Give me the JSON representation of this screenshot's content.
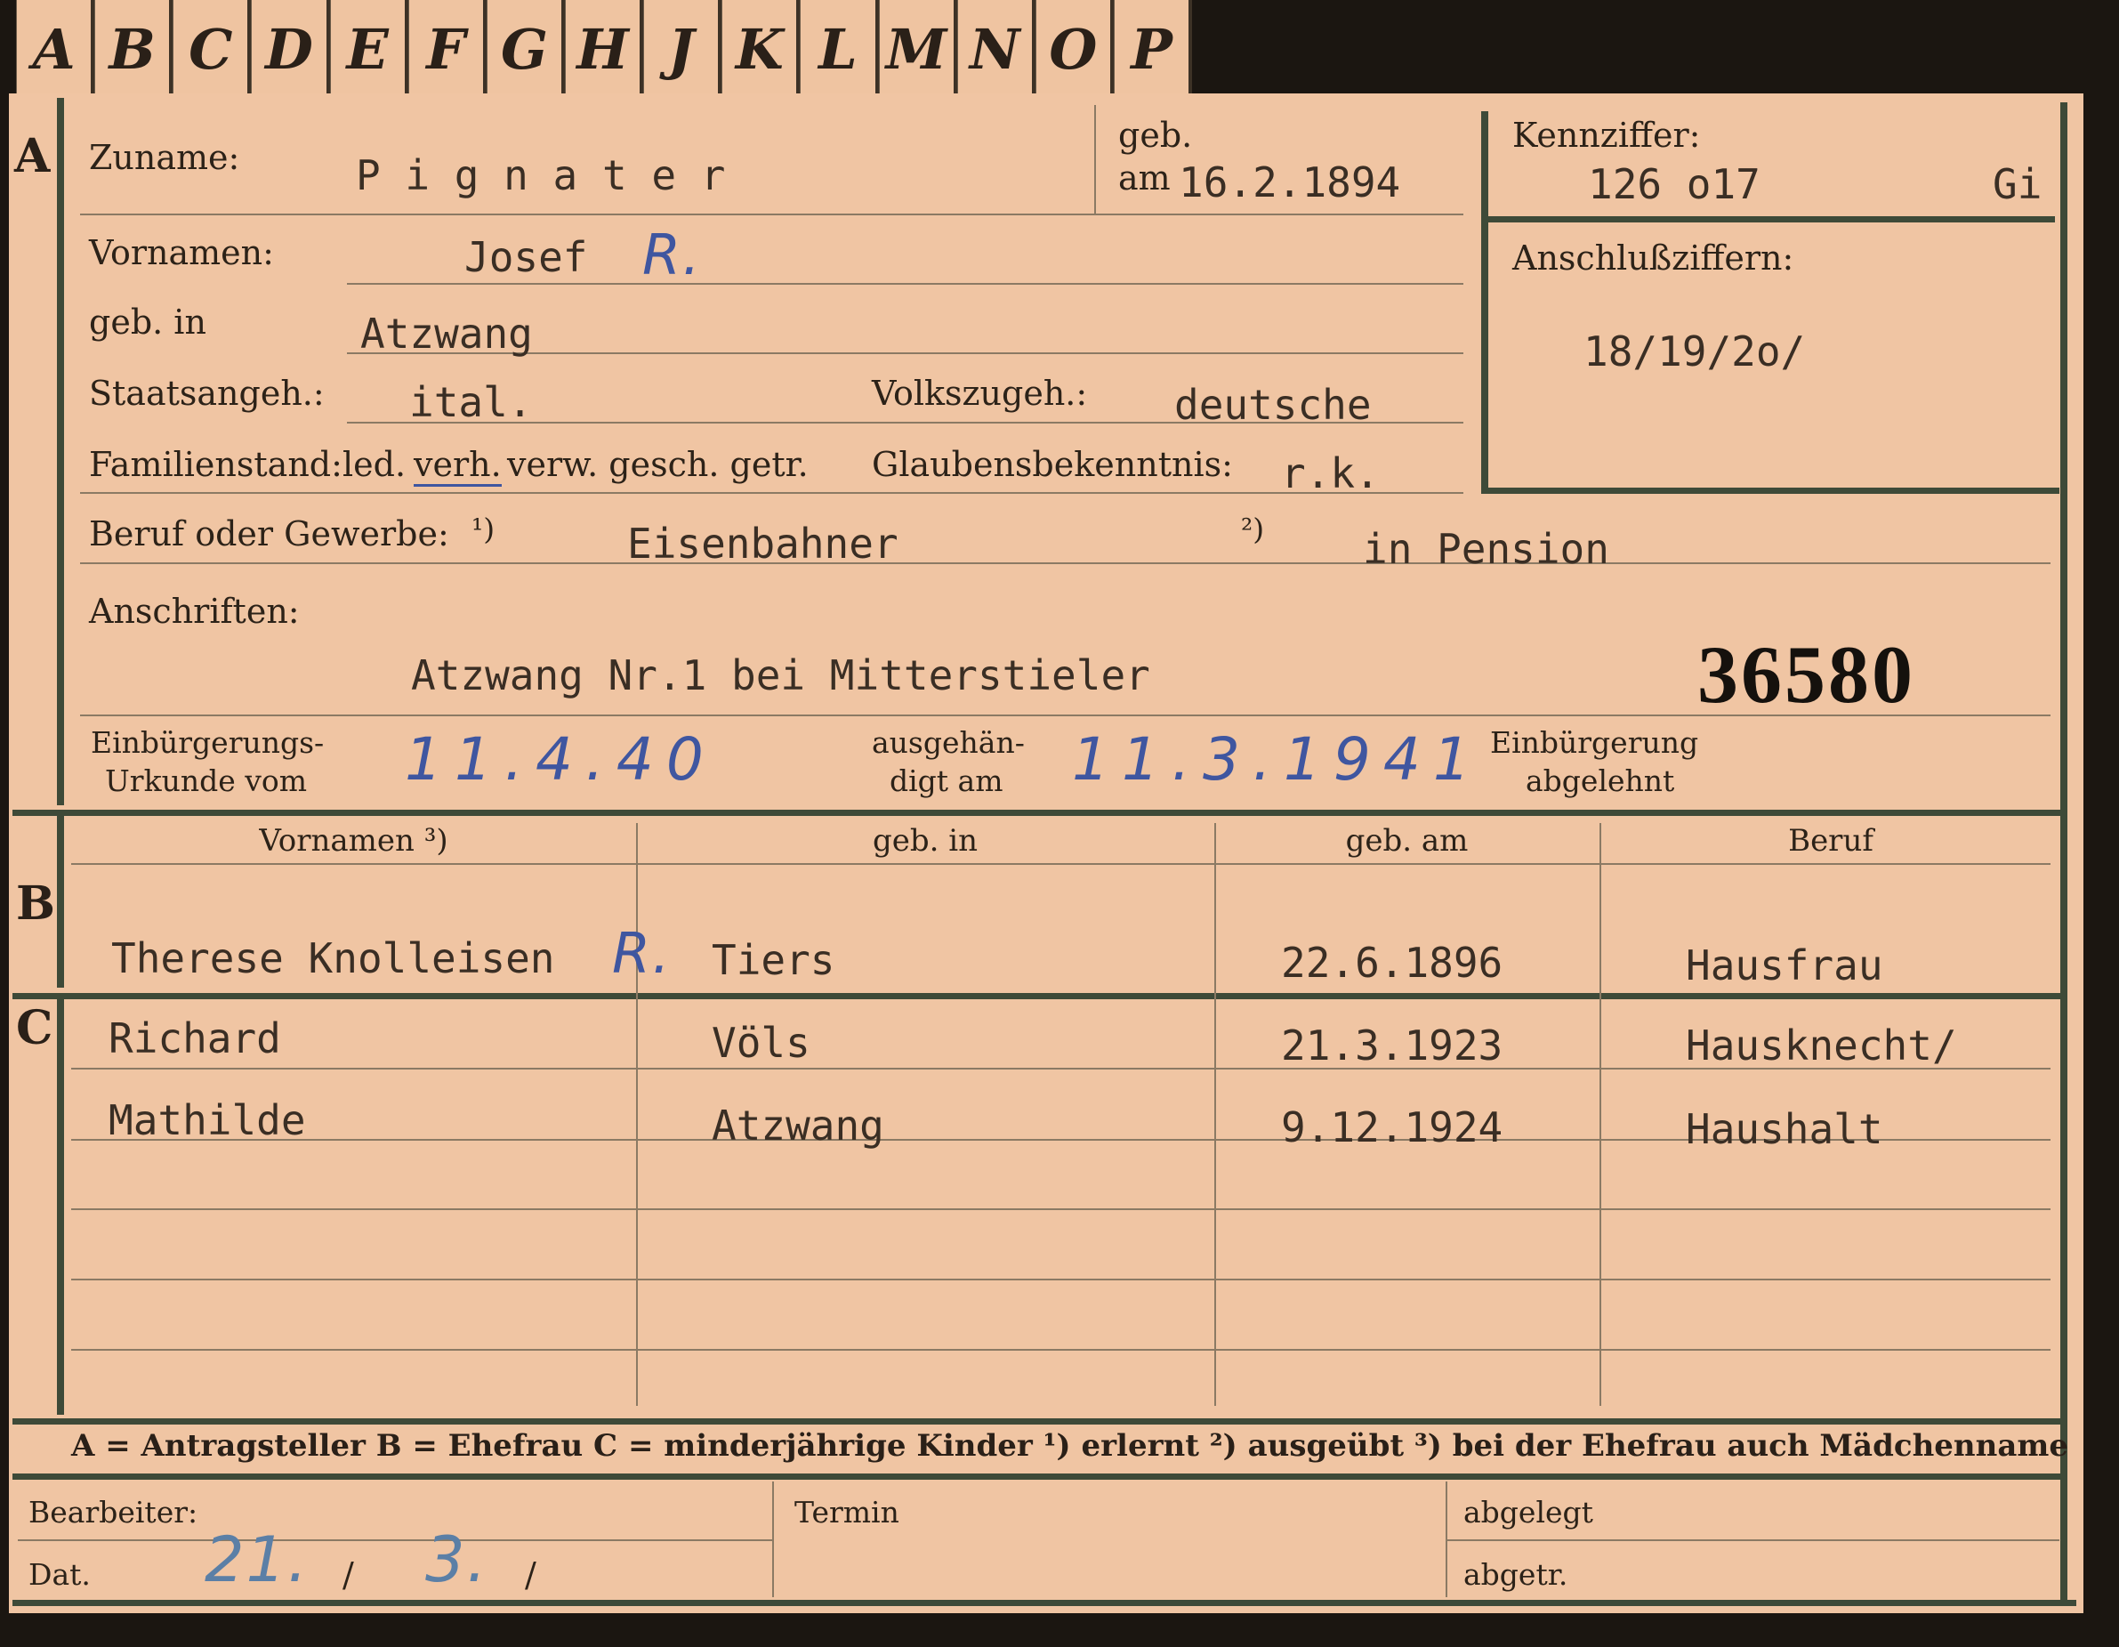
{
  "tabs": [
    "A",
    "B",
    "C",
    "D",
    "E",
    "F",
    "G",
    "H",
    "J",
    "K",
    "L",
    "M",
    "N",
    "O",
    "P"
  ],
  "section_letters": {
    "a": "A",
    "b": "B",
    "c": "C"
  },
  "labels": {
    "zuname": "Zuname:",
    "geb": "geb.",
    "am": "am",
    "kennziffer": "Kennziffer:",
    "vornamen": "Vornamen:",
    "anschlussziffern": "Anschlußziffern:",
    "geb_in": "geb. in",
    "staatsangeh": "Staatsangeh.:",
    "volkszugeh": "Volkszugeh.:",
    "familienstand": "Familienstand:",
    "fam_led": "led.",
    "fam_verh": "verh.",
    "fam_rest": "verw. gesch. getr.",
    "glaubensbekenntnis": "Glaubensbekenntnis:",
    "beruf": "Beruf oder Gewerbe:",
    "fn1": "¹)",
    "fn2": "²)",
    "anschriften": "Anschriften:",
    "einbuergerung_l1": "Einbürgerungs-",
    "einbuergerung_l2": "Urkunde vom",
    "ausgehaendigt_l1": "ausgehän-",
    "ausgehaendigt_l2": "digt am",
    "abgelehnt_l1": "Einbürgerung",
    "abgelehnt_l2": "abgelehnt",
    "bearbeiter": "Bearbeiter:",
    "dat": "Dat.",
    "termin": "Termin",
    "abgelegt": "abgelegt",
    "abgetr": "abgetr."
  },
  "values": {
    "zuname": "P i g n a t e r",
    "geb_am": "16.2.1894",
    "kennziffer": "126 o17",
    "kennziffer_suffix": "Gi",
    "vornamen": "Josef",
    "vornamen_mark": "R.",
    "anschlussziffern": "18/19/2o/",
    "geb_in": "Atzwang",
    "staatsangeh": "ital.",
    "volkszugeh": "deutsche",
    "glaubensbekenntnis": "r.k.",
    "beruf_erlernt": "Eisenbahner",
    "beruf_ausgeuebt": "in Pension",
    "anschrift": "Atzwang Nr.1 bei Mitterstieler",
    "nummer": "36580",
    "urkunde_vom": "11.4.40",
    "ausgehaendigt_am": "11.3.1941",
    "bearbeiter_day": "21.",
    "bearbeiter_month": "3."
  },
  "table_headers": [
    "Vornamen ³)",
    "geb. in",
    "geb. am",
    "Beruf"
  ],
  "spouse": {
    "vornamen": "Therese Knolleisen",
    "mark": "R.",
    "geb_in": "Tiers",
    "geb_am": "22.6.1896",
    "beruf": "Hausfrau"
  },
  "children": [
    {
      "vornamen": "Richard",
      "geb_in": "Völs",
      "geb_am": "21.3.1923",
      "beruf": "Hausknecht/"
    },
    {
      "vornamen": "Mathilde",
      "geb_in": "Atzwang",
      "geb_am": "9.12.1924",
      "beruf": "Haushalt"
    }
  ],
  "legend": "A = Antragsteller   B = Ehefrau   C = minderjährige Kinder   ¹) erlernt   ²) ausgeübt   ³) bei der Ehefrau auch Mädchenname",
  "colors": {
    "card": "#f0c5a3",
    "ink_blue": "#3f56a0",
    "frame": "#3e4a38"
  }
}
